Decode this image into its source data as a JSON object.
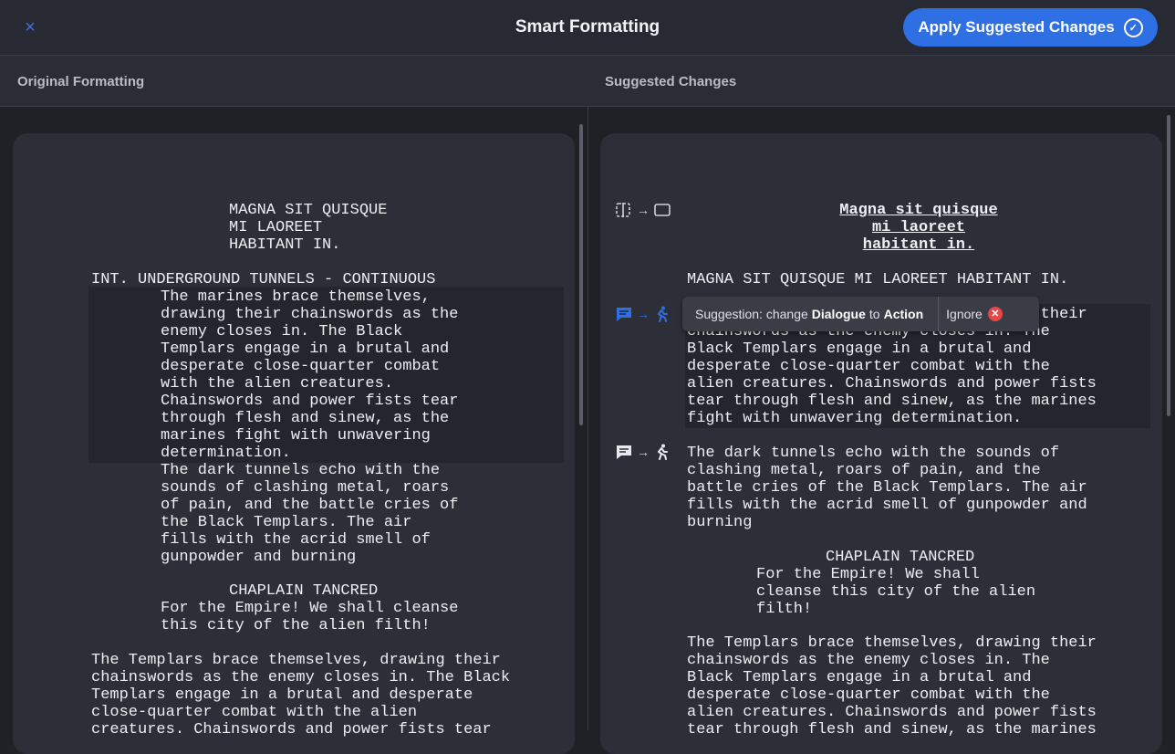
{
  "header": {
    "title": "Smart Formatting",
    "close_icon": "×",
    "apply_label": "Apply Suggested Changes",
    "apply_icon": "✓"
  },
  "columns": {
    "left": "Original Formatting",
    "right": "Suggested Changes"
  },
  "original": {
    "title_lines": "MAGNA SIT QUISQUE\nMI LAOREET\nHABITANT IN.",
    "scene_heading": "INT. UNDERGROUND TUNNELS - CONTINUOUS",
    "block1": "The marines brace themselves,\ndrawing their chainswords as the\nenemy closes in. The Black\nTemplars engage in a brutal and\ndesperate close-quarter combat\nwith the alien creatures.\nChainswords and power fists tear\nthrough flesh and sinew, as the\nmarines fight with unwavering\ndetermination.",
    "block2": "The dark tunnels echo with the\nsounds of clashing metal, roars\nof pain, and the battle cries of\nthe Black Templars. The air\nfills with the acrid smell of\ngunpowder and burning",
    "character": "CHAPLAIN TANCRED",
    "dialogue": "For the Empire! We shall cleanse\nthis city of the alien filth!",
    "action": "The Templars brace themselves, drawing their\nchainswords as the enemy closes in. The Black\nTemplars engage in a brutal and desperate\nclose-quarter combat with the alien\ncreatures. Chainswords and power fists tear"
  },
  "suggested": {
    "title_lines": [
      "Magna sit quisque",
      "mi laoreet",
      "habitant in."
    ],
    "heading": "MAGNA SIT QUISQUE MI LAOREET HABITANT IN.",
    "block1": "                                  ing their\nchainswords as the enemy closes in. The\nBlack Templars engage in a brutal and\ndesperate close-quarter combat with the\nalien creatures. Chainswords and power fists\ntear through flesh and sinew, as the marines\nfight with unwavering determination.",
    "block2": "The dark tunnels echo with the sounds of\nclashing metal, roars of pain, and the\nbattle cries of the Black Templars. The air\nfills with the acrid smell of gunpowder and\nburning",
    "character": "CHAPLAIN TANCRED",
    "dialogue": "For the Empire! We shall\ncleanse this city of the alien\nfilth!",
    "action": "The Templars brace themselves, drawing their\nchainswords as the enemy closes in. The\nBlack Templars engage in a brutal and\ndesperate close-quarter combat with the\nalien creatures. Chainswords and power fists\ntear through flesh and sinew, as the marines"
  },
  "tooltip": {
    "prefix": "Suggestion: change",
    "from": "Dialogue",
    "to_word": "to",
    "to": "Action",
    "ignore": "Ignore",
    "ignore_icon": "✕"
  },
  "icons": {
    "arrow": "→",
    "dialogue": "dialogue-icon",
    "action": "action-icon"
  },
  "colors": {
    "accent": "#2f6fe4",
    "ignore_red": "#e54848"
  }
}
